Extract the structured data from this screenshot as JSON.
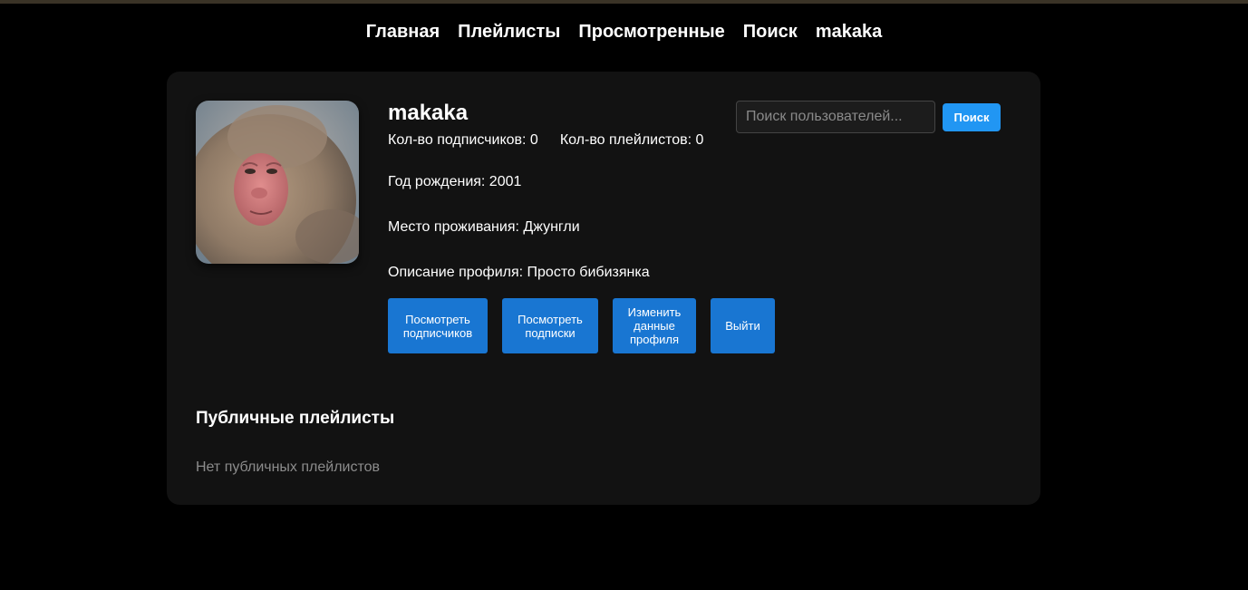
{
  "nav": {
    "items": [
      {
        "label": "Главная"
      },
      {
        "label": "Плейлисты"
      },
      {
        "label": "Просмотренные"
      },
      {
        "label": "Поиск"
      },
      {
        "label": "makaka"
      }
    ]
  },
  "profile": {
    "username": "makaka",
    "followers_text": "Кол-во подписчиков: 0",
    "playlists_text": "Кол-во плейлистов: 0",
    "birth_year_text": "Год рождения: 2001",
    "place_text": "Место проживания: Джунгли",
    "description_text": "Описание профиля: Просто бибизянка"
  },
  "actions": {
    "view_followers_label": "Посмотреть подписчиков",
    "view_following_label": "Посмотреть подписки",
    "edit_profile_label": "Изменить данные профиля",
    "logout_label": "Выйти"
  },
  "user_search": {
    "placeholder": "Поиск пользователей...",
    "button_label": "Поиск"
  },
  "playlists_section": {
    "title": "Публичные плейлисты",
    "empty_text": "Нет публичных плейлистов"
  },
  "colors": {
    "background": "#000000",
    "card": "#121212",
    "button_primary": "#1976d2",
    "search_button": "#2196f3",
    "muted_text": "#8c8c8c"
  },
  "icons": {
    "avatar": "monkey-avatar-photo"
  }
}
